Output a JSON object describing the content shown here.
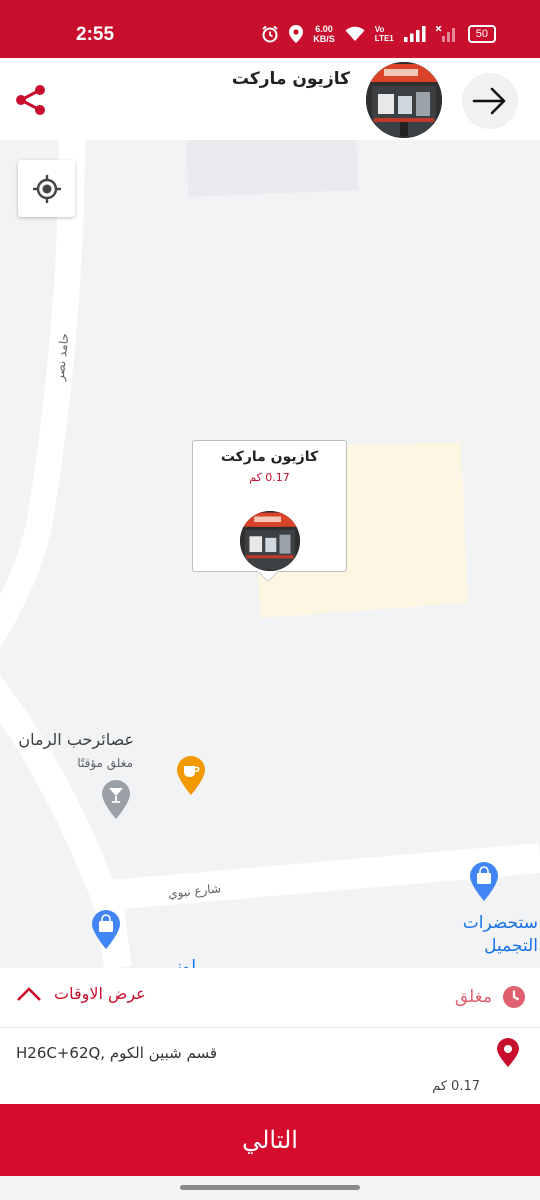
{
  "status_bar": {
    "time": "2:55",
    "speed_value": "6.00",
    "speed_unit": "KB/S",
    "volte_top": "Vo",
    "volte_bottom": "LTE",
    "lte_sub": "1",
    "battery": "50",
    "icons": [
      "alarm-icon",
      "location-icon",
      "wifi-icon",
      "signal-icon",
      "signal-no-service-icon",
      "battery-icon"
    ]
  },
  "header": {
    "store_name": "كازيون ماركت",
    "icons": [
      "share-icon",
      "arrow-right-icon"
    ]
  },
  "map": {
    "road_label": "حامد نصر",
    "street_label": "شارع نبوي",
    "poi_name": "عصائرحب الرمان",
    "poi_status": "مغلق مؤقتًا",
    "cosmetics_line1": "ستحضرات",
    "cosmetics_line2": "التجميل",
    "partial_label": "لوز",
    "callout_name": "كازيون ماركت",
    "callout_distance": "0.17 كم",
    "icons": [
      "locate-icon",
      "cafe-pin-icon",
      "bar-pin-icon",
      "shopping-pin-icon"
    ]
  },
  "hours": {
    "toggle_label": "عرض الاوقات",
    "status_label": "مغلق",
    "icons": [
      "chevron-up-icon",
      "clock-icon"
    ]
  },
  "address": {
    "text": "H26C+62Q, قسم شبين الكوم",
    "distance": "0.17 كم",
    "icons": [
      "map-pin-icon"
    ]
  },
  "next_button": {
    "label": "التالي"
  },
  "colors": {
    "brand_red": "#c8102e",
    "button_red": "#d50c2e",
    "map_blue": "#1a73e8",
    "cafe_orange": "#f29900"
  }
}
